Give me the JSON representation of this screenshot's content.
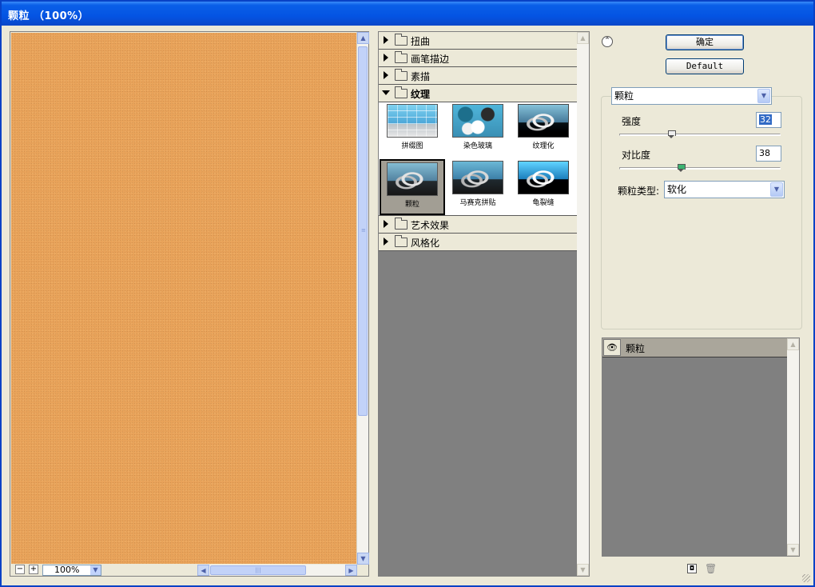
{
  "window": {
    "title": "颗粒 （100%）"
  },
  "preview": {
    "zoom_out": "−",
    "zoom_in": "+",
    "zoom_value": "100%"
  },
  "gallery": {
    "categories_top": [
      {
        "label": "扭曲"
      },
      {
        "label": "画笔描边"
      },
      {
        "label": "素描"
      }
    ],
    "open_category": {
      "label": "纹理"
    },
    "thumbnails": [
      {
        "caption": "拼缀图",
        "selected": false
      },
      {
        "caption": "染色玻璃",
        "selected": false
      },
      {
        "caption": "纹理化",
        "selected": false
      },
      {
        "caption": "颗粒",
        "selected": true
      },
      {
        "caption": "马赛克拼贴",
        "selected": false
      },
      {
        "caption": "龟裂缝",
        "selected": false
      }
    ],
    "categories_bottom": [
      {
        "label": "艺术效果"
      },
      {
        "label": "风格化"
      }
    ]
  },
  "actions": {
    "ok_label": "确定",
    "default_label": "Default"
  },
  "settings": {
    "filter_select": "颗粒",
    "intensity": {
      "label": "强度",
      "value": "32",
      "fraction": 0.32
    },
    "contrast": {
      "label": "对比度",
      "value": "38",
      "fraction": 0.38
    },
    "grain_type": {
      "label": "颗粒类型:",
      "value": "软化"
    }
  },
  "layers": {
    "items": [
      {
        "name": "颗粒"
      }
    ]
  },
  "colors": {
    "preview_fill": "#e9a35a",
    "titlebar": "#0454e3",
    "panel_bg": "#ece9d8"
  }
}
